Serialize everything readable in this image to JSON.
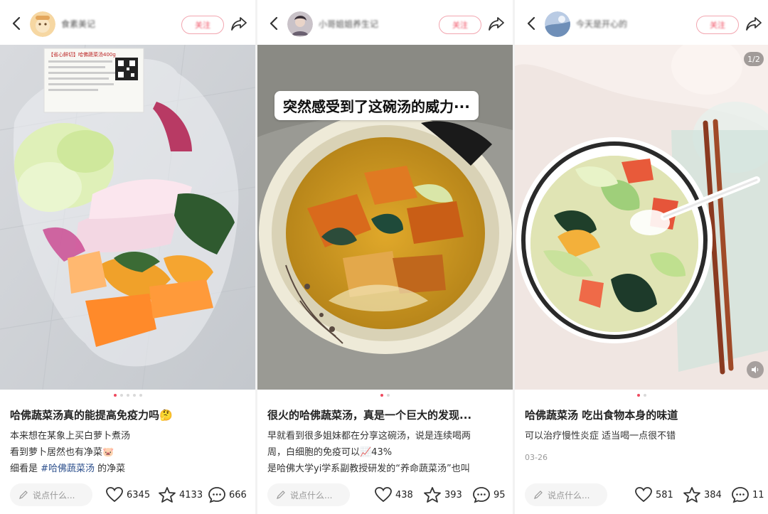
{
  "posts": [
    {
      "username": "食素美记",
      "follow_label": "关注",
      "title": "哈佛蔬菜汤真的能提高免疫力吗🤔",
      "body_lines": [
        "本来想在某象上买白萝卜煮汤",
        "看到萝卜居然也有净菜🐷"
      ],
      "body_last_prefix": "细看是 ",
      "hashtag": "#哈佛蔬菜汤",
      "body_last_suffix": " 的净菜",
      "comment_placeholder": "说点什么...",
      "likes": "6345",
      "stars": "4133",
      "comments": "666",
      "dots_total": 5,
      "dot_active": 0,
      "package_label": "【省心鲜切】哈佛蔬菜汤400g"
    },
    {
      "username": "小哥姐姐养生记",
      "follow_label": "关注",
      "overlay": "突然感受到了这碗汤的威力···",
      "title": "很火的哈佛蔬菜汤，真是一个巨大的发现...",
      "body_lines": [
        "早就看到很多姐妹都在分享这碗汤，说是连续喝两",
        "周，白细胞的免疫可以📈43%",
        "是哈佛大学yi学系副教授研发的“养命蔬菜汤”也叫"
      ],
      "comment_placeholder": "说点什么...",
      "likes": "438",
      "stars": "393",
      "comments": "95",
      "dots_total": 2,
      "dot_active": 0
    },
    {
      "username": "今天是开心的",
      "follow_label": "关注",
      "pager": "1/2",
      "title": "哈佛蔬菜汤 吃出食物本身的味道",
      "body_lines": [
        "可以治疗慢性炎症 适当喝一点很不错"
      ],
      "date": "03-26",
      "comment_placeholder": "说点什么...",
      "likes": "581",
      "stars": "384",
      "comments": "11",
      "dots_total": 2,
      "dot_active": 0
    }
  ],
  "colors": {
    "accent": "#ef4a5f",
    "hashtag": "#2c4f8c",
    "follow_border": "#f2a6b0"
  }
}
